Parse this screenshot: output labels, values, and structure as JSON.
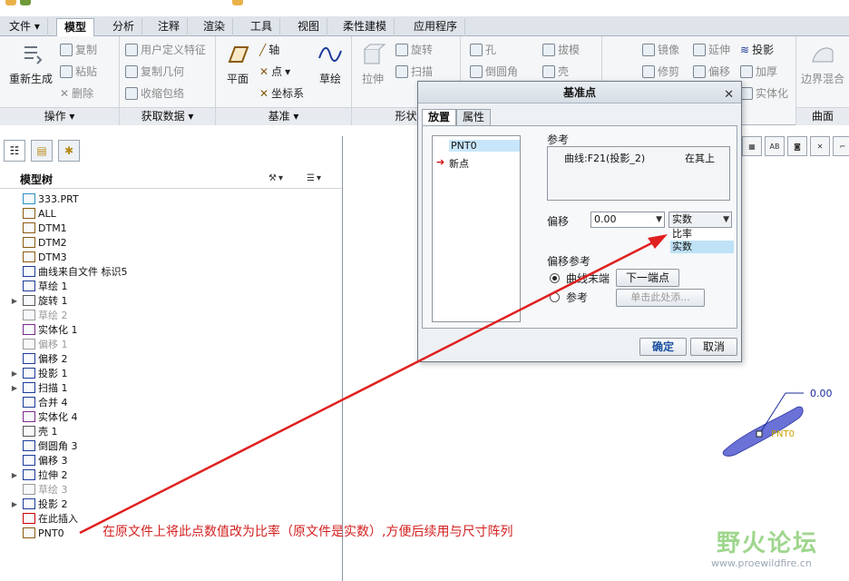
{
  "tabs": [
    {
      "label": "文件 ▾"
    },
    {
      "label": "模型"
    },
    {
      "label": "分析"
    },
    {
      "label": "注释"
    },
    {
      "label": "渲染"
    },
    {
      "label": "工具"
    },
    {
      "label": "视图"
    },
    {
      "label": "柔性建模"
    },
    {
      "label": "应用程序"
    }
  ],
  "ribbon": {
    "ops": {
      "regen": "重新生成",
      "copy": "复制",
      "paste": "粘贴",
      "delete": "删除",
      "label": "操作 ▾"
    },
    "getdata": {
      "udf": "用户定义特征",
      "copygeom": "复制几何",
      "shrinkwrap": "收缩包络",
      "label": "获取数据 ▾"
    },
    "datum": {
      "plane": "平面",
      "axis": "轴",
      "point": "点",
      "csys": "坐标系",
      "sketch": "草绘",
      "label": "基准 ▾"
    },
    "shape": {
      "extrude": "拉伸",
      "revolve": "旋转",
      "sweep": "扫描",
      "label": "形状"
    },
    "eng": {
      "hole": "孔",
      "round": "倒圆角",
      "draft": "拔模",
      "shell": "壳"
    },
    "edit": {
      "mirror": "镜像",
      "trim": "修剪",
      "extend": "延伸",
      "offset": "偏移",
      "project": "投影",
      "thicken": "加厚",
      "solidify": "实体化"
    },
    "surface": {
      "boundary": "边界混合",
      "label": "曲面"
    }
  },
  "tree": {
    "title": "模型树",
    "items": [
      {
        "label": "333.PRT",
        "exp": ""
      },
      {
        "label": "ALL",
        "exp": ""
      },
      {
        "label": "DTM1",
        "exp": ""
      },
      {
        "label": "DTM2",
        "exp": ""
      },
      {
        "label": "DTM3",
        "exp": ""
      },
      {
        "label": "曲线来自文件 标识5",
        "exp": ""
      },
      {
        "label": "草绘 1",
        "exp": ""
      },
      {
        "label": "旋转 1",
        "exp": "▶"
      },
      {
        "label": "草绘 2",
        "exp": "",
        "dim": true
      },
      {
        "label": "实体化 1",
        "exp": ""
      },
      {
        "label": "偏移 1",
        "exp": "",
        "dim": true
      },
      {
        "label": "偏移 2",
        "exp": ""
      },
      {
        "label": "投影 1",
        "exp": "▶"
      },
      {
        "label": "扫描 1",
        "exp": "▶"
      },
      {
        "label": "合并 4",
        "exp": ""
      },
      {
        "label": "实体化 4",
        "exp": ""
      },
      {
        "label": "壳 1",
        "exp": ""
      },
      {
        "label": "倒圆角 3",
        "exp": ""
      },
      {
        "label": "偏移 3",
        "exp": ""
      },
      {
        "label": "拉伸 2",
        "exp": "▶"
      },
      {
        "label": "草绘 3",
        "exp": "",
        "dim": true
      },
      {
        "label": "投影 2",
        "exp": "▶"
      },
      {
        "label": "在此插入",
        "exp": ""
      },
      {
        "label": "PNT0",
        "exp": ""
      }
    ]
  },
  "dialog": {
    "title": "基准点",
    "close": "✕",
    "tab_placement": "放置",
    "tab_props": "属性",
    "list": {
      "item1": "PNT0",
      "item2": "新点"
    },
    "ref_label": "参考",
    "ref_curve": "曲线:F21(投影_2)",
    "ref_on": "在其上",
    "offset_label": "偏移",
    "offset_value": "0.00",
    "offset_type": "实数",
    "options": {
      "ratio": "比率",
      "real": "实数"
    },
    "offset_ref_label": "偏移参考",
    "radio_curve_end": "曲线末端",
    "radio_ref": "参考",
    "next_end": "下一端点",
    "click_add": "单击此处添...",
    "ok": "确定",
    "cancel": "取消"
  },
  "annotation": "在原文件上将此点数值改为比率（原文件是实数）,方便后续用与尺寸阵列",
  "viewport": {
    "dim_value": "0.00",
    "point_label": "PNT0"
  },
  "watermark": {
    "title": "野火论坛",
    "url": "www.proewildfire.cn"
  },
  "colors": {
    "accent": "#1a4fa0",
    "annotation": "#d42020",
    "highlight": "#bfe2f7",
    "model": "#6a72d8"
  }
}
